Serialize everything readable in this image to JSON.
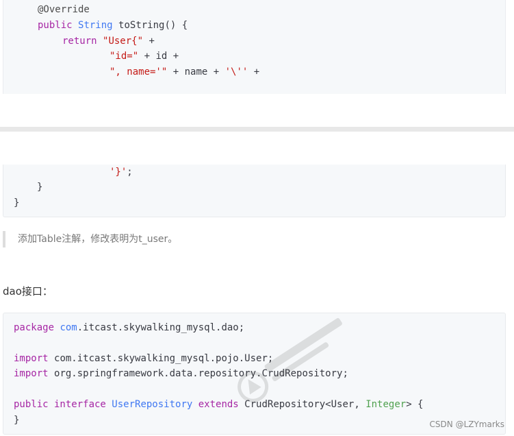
{
  "code_block_1": {
    "lines": [
      [
        {
          "c": "ann",
          "t": "@Override"
        }
      ],
      [
        {
          "c": "kw",
          "t": "public "
        },
        {
          "c": "ty",
          "t": "String "
        },
        {
          "c": "",
          "t": "toString() {"
        }
      ],
      [
        {
          "c": "kw",
          "t": "return "
        },
        {
          "c": "st",
          "t": "\"User{\""
        },
        {
          "c": "",
          "t": " +"
        }
      ],
      [
        {
          "c": "st",
          "t": "\"id=\""
        },
        {
          "c": "",
          "t": " + id +"
        }
      ],
      [
        {
          "c": "st",
          "t": "\", name='\""
        },
        {
          "c": "",
          "t": " + name + "
        },
        {
          "c": "st",
          "t": "'\\''"
        },
        {
          "c": "",
          "t": " +"
        }
      ]
    ]
  },
  "code_block_2": {
    "lines": [
      [
        {
          "c": "st",
          "t": "'}'"
        },
        {
          "c": "",
          "t": ";"
        }
      ],
      [
        {
          "c": "",
          "t": "}"
        }
      ],
      [
        {
          "c": "",
          "t": "}"
        }
      ]
    ]
  },
  "note_text": "添加Table注解，修改表明为t_user。",
  "dao_label": "dao接口：",
  "code_block_3": {
    "lines": [
      [
        {
          "c": "kw",
          "t": "package "
        },
        {
          "c": "ty",
          "t": "com"
        },
        {
          "c": "",
          "t": ".itcast.skywalking_mysql.dao;"
        }
      ],
      [],
      [
        {
          "c": "kw",
          "t": "import "
        },
        {
          "c": "",
          "t": "com.itcast.skywalking_mysql.pojo.User;"
        }
      ],
      [
        {
          "c": "kw",
          "t": "import "
        },
        {
          "c": "",
          "t": "org.springframework.data.repository.CrudRepository;"
        }
      ],
      [],
      [
        {
          "c": "kw",
          "t": "public interface "
        },
        {
          "c": "ty",
          "t": "UserRepository "
        },
        {
          "c": "kw",
          "t": "extends "
        },
        {
          "c": "",
          "t": "CrudRepository<User, "
        },
        {
          "c": "gn",
          "t": "Integer"
        },
        {
          "c": "",
          "t": "> {"
        }
      ],
      [
        {
          "c": "",
          "t": "}"
        }
      ]
    ]
  },
  "watermark_icon": "blackhorse-programmer-logo",
  "csdn_mark": "CSDN @LZYmarks"
}
